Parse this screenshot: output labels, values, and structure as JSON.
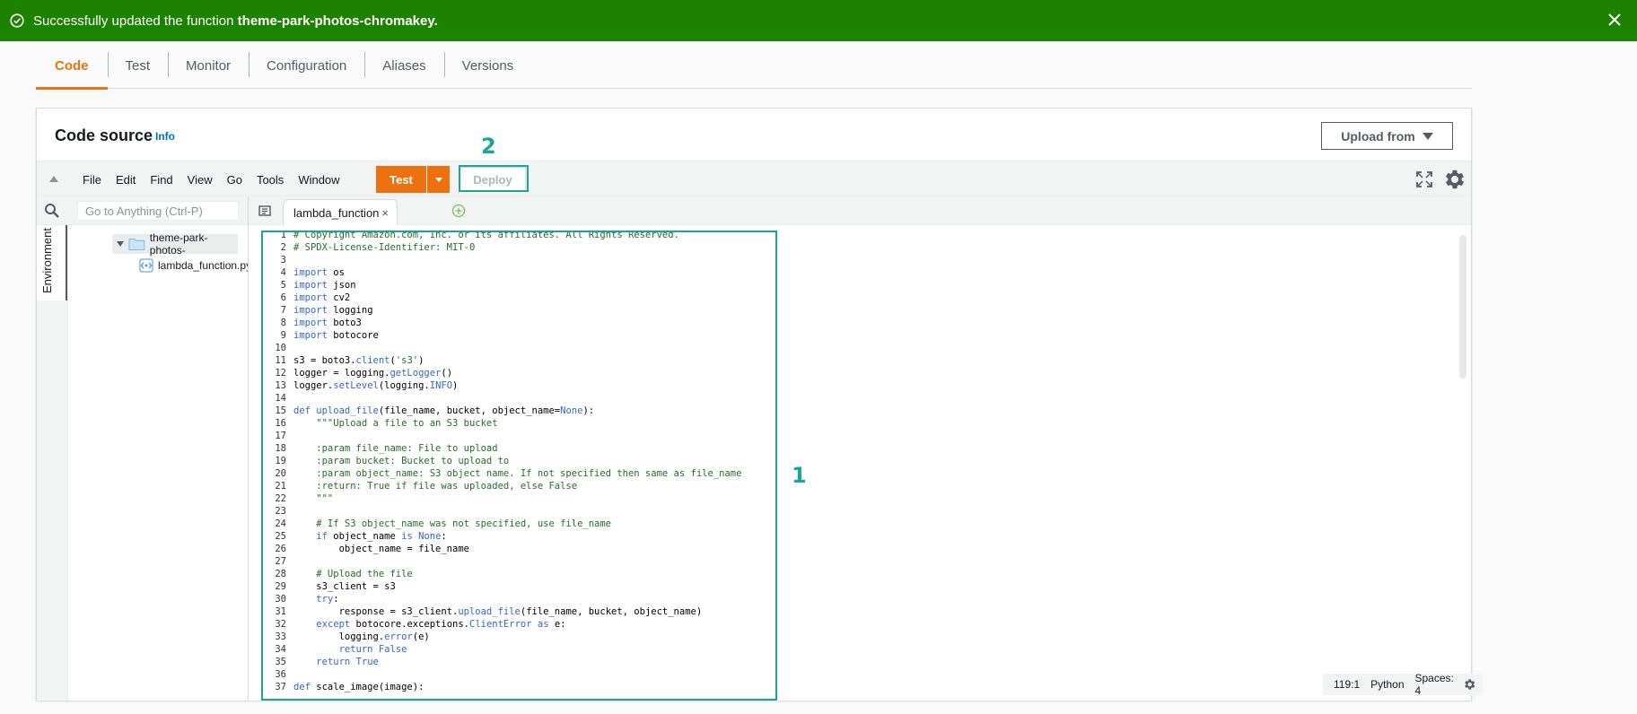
{
  "banner": {
    "message_prefix": "Successfully updated the function ",
    "function_name": "theme-park-photos-chromakey.",
    "icons": [
      "check-circle-icon",
      "close-icon"
    ],
    "color": "#1d8102"
  },
  "tabs": [
    {
      "label": "Code",
      "active": true
    },
    {
      "label": "Test"
    },
    {
      "label": "Monitor"
    },
    {
      "label": "Configuration"
    },
    {
      "label": "Aliases"
    },
    {
      "label": "Versions"
    }
  ],
  "panel": {
    "title": "Code source",
    "info": "Info",
    "upload_label": "Upload from"
  },
  "ide": {
    "menu": [
      "File",
      "Edit",
      "Find",
      "View",
      "Go",
      "Tools",
      "Window"
    ],
    "test_label": "Test",
    "deploy_label": "Deploy",
    "accent": "#ec7211"
  },
  "markers": {
    "code": "1",
    "deploy": "2",
    "color": "#1ba598"
  },
  "tree": {
    "search_placeholder": "Go to Anything (Ctrl-P)",
    "environment_label": "Environment",
    "folder": "theme-park-photos-",
    "file": "lambda_function.py"
  },
  "editor": {
    "tab_label": "lambda_function",
    "tab_close": "×",
    "lines": [
      "# Copyright Amazon.com, Inc. or its affiliates. All Rights Reserved.",
      "# SPDX-License-Identifier: MIT-0",
      "",
      "import os",
      "import json",
      "import cv2",
      "import logging",
      "import boto3",
      "import botocore",
      "",
      "s3 = boto3.client('s3')",
      "logger = logging.getLogger()",
      "logger.setLevel(logging.INFO)",
      "",
      "def upload_file(file_name, bucket, object_name=None):",
      "    \"\"\"Upload a file to an S3 bucket",
      "",
      "    :param file_name: File to upload",
      "    :param bucket: Bucket to upload to",
      "    :param object_name: S3 object name. If not specified then same as file_name",
      "    :return: True if file was uploaded, else False",
      "    \"\"\"",
      "",
      "    # If S3 object_name was not specified, use file_name",
      "    if object_name is None:",
      "        object_name = file_name",
      "",
      "    # Upload the file",
      "    s3_client = s3",
      "    try:",
      "        response = s3_client.upload_file(file_name, bucket, object_name)",
      "    except botocore.exceptions.ClientError as e:",
      "        logging.error(e)",
      "        return False",
      "    return True",
      "",
      "def scale_image(image):"
    ]
  },
  "status": {
    "position": "119:1",
    "language": "Python",
    "spaces": "Spaces: 4"
  }
}
